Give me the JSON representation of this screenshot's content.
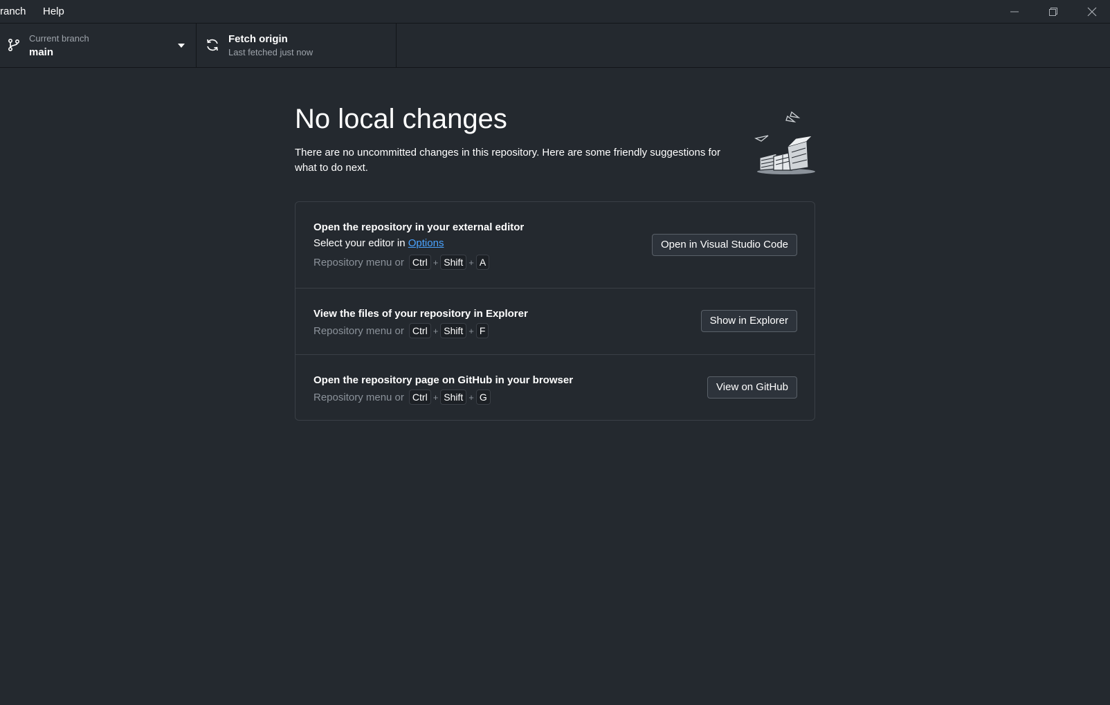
{
  "menu": {
    "items": [
      "ranch",
      "Help"
    ]
  },
  "window_controls": {
    "minimize": "minimize-icon",
    "restore": "restore-icon",
    "close": "close-icon"
  },
  "toolbar": {
    "branch": {
      "label": "Current branch",
      "value": "main"
    },
    "fetch": {
      "label": "Fetch origin",
      "status": "Last fetched just now"
    }
  },
  "main": {
    "title": "No local changes",
    "subtitle": "There are no uncommitted changes in this repository. Here are some friendly suggestions for what to do next.",
    "cards": [
      {
        "title": "Open the repository in your external editor",
        "desc_prefix": "Select your editor in ",
        "desc_link": "Options",
        "shortcut_prefix": "Repository menu or",
        "keys": [
          "Ctrl",
          "Shift",
          "A"
        ],
        "button": "Open in Visual Studio Code"
      },
      {
        "title": "View the files of your repository in Explorer",
        "shortcut_prefix": "Repository menu or",
        "keys": [
          "Ctrl",
          "Shift",
          "F"
        ],
        "button": "Show in Explorer"
      },
      {
        "title": "Open the repository page on GitHub in your browser",
        "shortcut_prefix": "Repository menu or",
        "keys": [
          "Ctrl",
          "Shift",
          "G"
        ],
        "button": "View on GitHub"
      }
    ],
    "shortcut_plus": "+"
  },
  "colors": {
    "background": "#24292f",
    "border": "#3a3f46",
    "link": "#4aa3ff",
    "muted_text": "#8b929a"
  }
}
